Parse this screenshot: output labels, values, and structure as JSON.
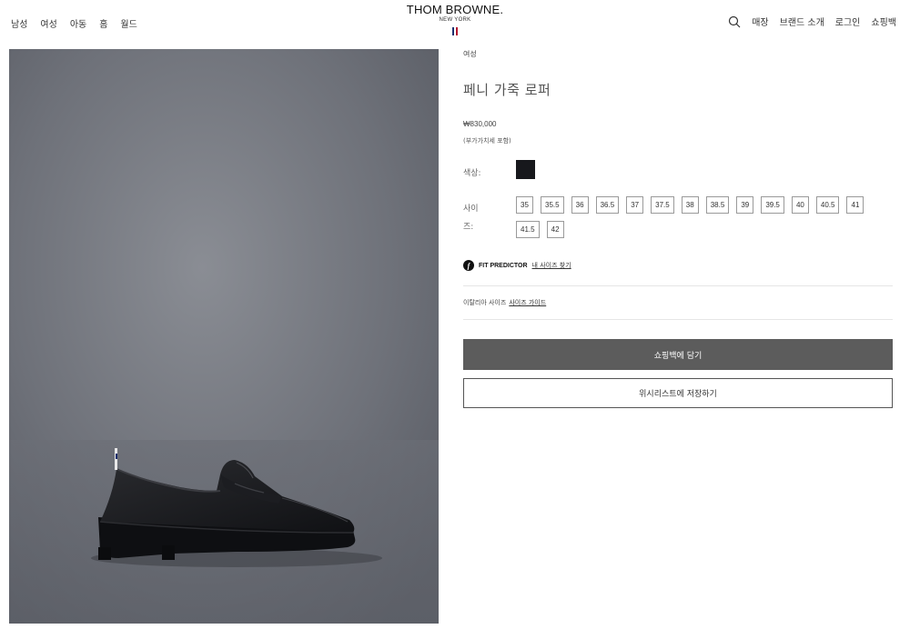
{
  "header": {
    "nav_left": [
      "남성",
      "여성",
      "아동",
      "홈",
      "월드"
    ],
    "brand": "THOM BROWNE.",
    "brand_sub": "NEW YORK",
    "flag_colors": [
      "#1b2f6e",
      "#ffffff",
      "#b3112e"
    ],
    "search_icon": "search-icon",
    "nav_right": [
      "매장",
      "브랜드 소개",
      "로그인",
      "쇼핑백"
    ]
  },
  "product": {
    "category": "여성",
    "title": "페니 가죽 로퍼",
    "price": "₩830,000",
    "vat_note": "(부가가치세 포함)",
    "color_label": "색상:",
    "color_swatch": "#17181c",
    "size_label": "사이즈:",
    "sizes": [
      "35",
      "35.5",
      "36",
      "36.5",
      "37",
      "37.5",
      "38",
      "38.5",
      "39",
      "39.5",
      "40",
      "40.5",
      "41",
      "41.5",
      "42"
    ],
    "fit_predictor_label": "FIT PREDICTOR",
    "fit_predictor_link": "내 사이즈 찾기",
    "size_system": "이탈리아 사이즈",
    "size_guide_link": "사이즈 가이드",
    "add_to_bag": "쇼핑백에 담기",
    "save_wishlist": "위시리스트에 저장하기"
  },
  "image": {
    "subject": "black pebble-grain penny loafer on grey background",
    "background_color": "#6d7078"
  }
}
